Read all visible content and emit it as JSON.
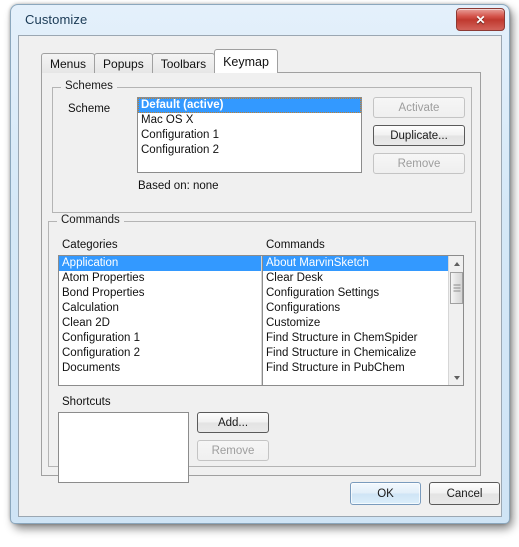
{
  "window": {
    "title": "Customize",
    "close_icon": "close-icon",
    "close_label": "✕"
  },
  "tabs": [
    {
      "label": "Menus",
      "active": false
    },
    {
      "label": "Popups",
      "active": false
    },
    {
      "label": "Toolbars",
      "active": false
    },
    {
      "label": "Keymap",
      "active": true
    }
  ],
  "schemes": {
    "group_label": "Schemes",
    "field_label": "Scheme",
    "items": [
      {
        "label": "Default (active)",
        "selected": true,
        "bold": true
      },
      {
        "label": "Mac OS X",
        "selected": false,
        "bold": false
      },
      {
        "label": "Configuration 1",
        "selected": false,
        "bold": false
      },
      {
        "label": "Configuration 2",
        "selected": false,
        "bold": false
      }
    ],
    "based_on": "Based on: none",
    "buttons": [
      {
        "label": "Activate",
        "enabled": false
      },
      {
        "label": "Duplicate...",
        "enabled": true
      },
      {
        "label": "Remove",
        "enabled": false
      }
    ]
  },
  "commands": {
    "group_label": "Commands",
    "categories_label": "Categories",
    "categories": [
      {
        "label": "Application",
        "selected": true
      },
      {
        "label": "Atom Properties",
        "selected": false
      },
      {
        "label": "Bond Properties",
        "selected": false
      },
      {
        "label": "Calculation",
        "selected": false
      },
      {
        "label": "Clean 2D",
        "selected": false
      },
      {
        "label": "Configuration 1",
        "selected": false
      },
      {
        "label": "Configuration 2",
        "selected": false
      },
      {
        "label": "Documents",
        "selected": false
      }
    ],
    "commands_label": "Commands",
    "commands_list": [
      {
        "label": "About MarvinSketch",
        "selected": true
      },
      {
        "label": "Clear Desk",
        "selected": false
      },
      {
        "label": "Configuration Settings",
        "selected": false
      },
      {
        "label": "Configurations",
        "selected": false
      },
      {
        "label": "Customize",
        "selected": false
      },
      {
        "label": "Find Structure in ChemSpider",
        "selected": false
      },
      {
        "label": "Find Structure in Chemicalize",
        "selected": false
      },
      {
        "label": "Find Structure in PubChem",
        "selected": false
      }
    ]
  },
  "shortcuts": {
    "label": "Shortcuts",
    "items": [],
    "buttons": [
      {
        "label": "Add...",
        "enabled": true
      },
      {
        "label": "Remove",
        "enabled": false
      }
    ]
  },
  "dialog_buttons": [
    {
      "label": "OK",
      "default": true
    },
    {
      "label": "Cancel",
      "default": false
    }
  ],
  "colors": {
    "selection": "#3399ff",
    "frame": "#cfe4f5",
    "client": "#f0f0f0",
    "close_red": "#c0392f"
  }
}
